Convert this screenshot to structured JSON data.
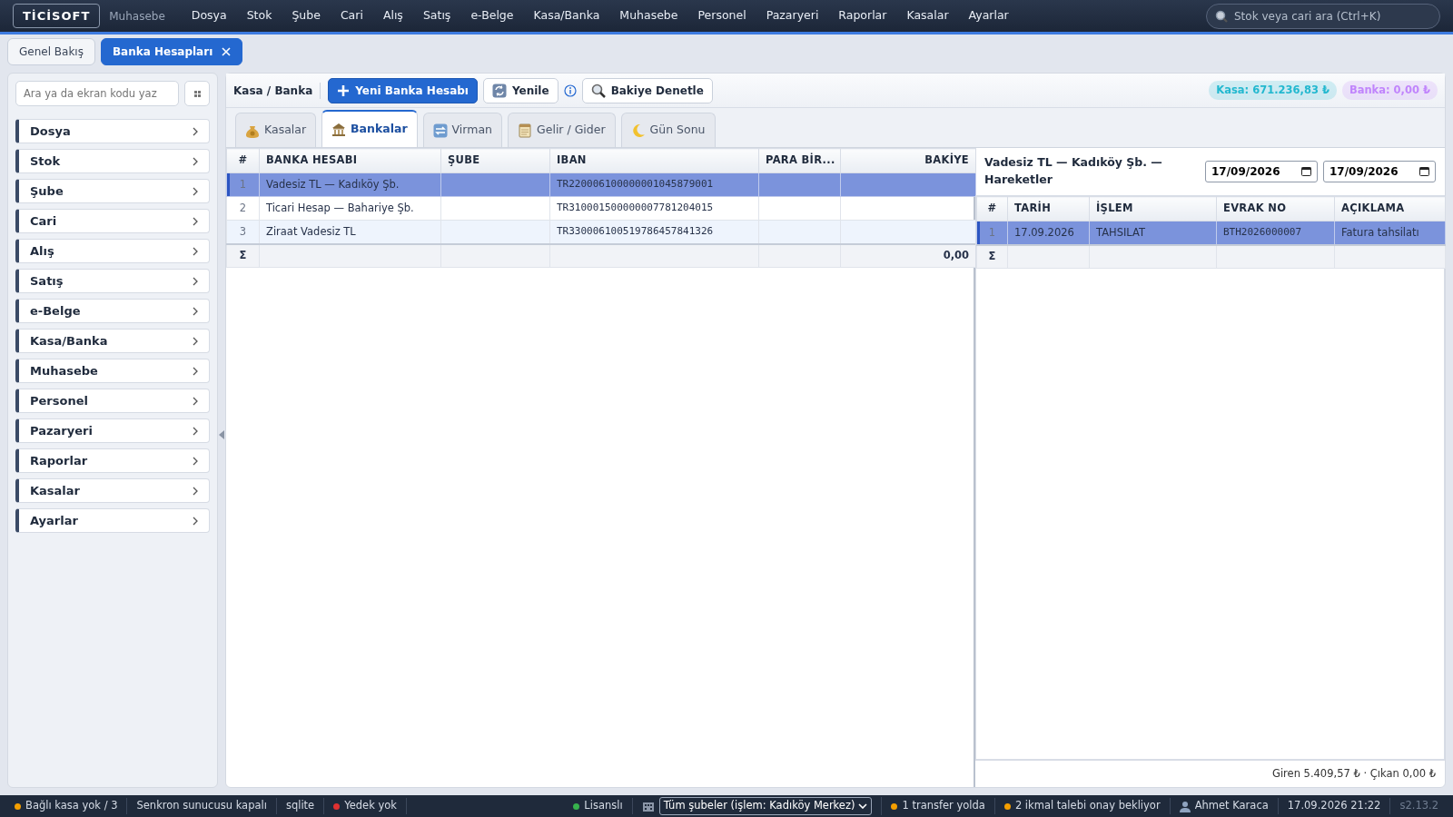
{
  "app": {
    "logo": "TİCİSOFT",
    "module": "Muhasebe"
  },
  "menu": [
    "Dosya",
    "Stok",
    "Şube",
    "Cari",
    "Alış",
    "Satış",
    "e-Belge",
    "Kasa/Banka",
    "Muhasebe",
    "Personel",
    "Pazaryeri",
    "Raporlar",
    "Kasalar",
    "Ayarlar"
  ],
  "search": {
    "placeholder": "Stok veya cari ara (Ctrl+K)"
  },
  "doc_tabs": [
    {
      "label": "Genel Bakış",
      "selected": false,
      "closable": false
    },
    {
      "label": "Banka Hesapları",
      "selected": true,
      "closable": true
    }
  ],
  "sidebar": {
    "search": {
      "placeholder": "Ara ya da ekran kodu yaz"
    },
    "items": [
      "Dosya",
      "Stok",
      "Şube",
      "Cari",
      "Alış",
      "Satış",
      "e-Belge",
      "Kasa/Banka",
      "Muhasebe",
      "Personel",
      "Pazaryeri",
      "Raporlar",
      "Kasalar",
      "Ayarlar"
    ]
  },
  "toolbar": {
    "title": "Kasa / Banka",
    "buttons": [
      {
        "label": "Yeni Banka Hesabı",
        "kind": "primary"
      },
      {
        "label": "Yenile",
        "kind": "secondary"
      },
      {
        "kind": "info"
      },
      {
        "label": "Bakiye Denetle",
        "kind": "secondary"
      }
    ],
    "badges": [
      {
        "text": "Kasa: 671.236,83 ₺",
        "color": "#22b8cf"
      },
      {
        "text": "Banka: 0,00 ₺",
        "color": "#c084fc"
      }
    ]
  },
  "tabs": [
    {
      "label": "Kasalar",
      "selected": false
    },
    {
      "label": "Bankalar",
      "selected": true
    },
    {
      "label": "Virman",
      "selected": false
    },
    {
      "label": "Gelir / Gider",
      "selected": false
    },
    {
      "label": "Gün Sonu",
      "selected": false
    }
  ],
  "accounts_table": {
    "columns": [
      "#",
      "BANKA HESABI",
      "ŞUBE",
      "IBAN",
      "PARA BİR...",
      "BAKİYE"
    ],
    "rows": [
      {
        "cells": [
          "1",
          "Vadesiz TL — Kadıköy Şb.",
          "",
          "TR220006100000001045879001",
          "",
          ""
        ],
        "selected": true
      },
      {
        "cells": [
          "2",
          "Ticari Hesap — Bahariye Şb.",
          "",
          "TR310001500000007781204015",
          "",
          ""
        ],
        "selected": false
      },
      {
        "cells": [
          "3",
          "Ziraat Vadesiz TL",
          "",
          "TR330006100519786457841326",
          "",
          ""
        ],
        "selected": false
      }
    ],
    "footer": {
      "symbol": "Σ",
      "total": "0,00"
    }
  },
  "movements": {
    "title": "Vadesiz TL — Kadıköy Şb. — Hareketler",
    "date_from": "17/09/2026",
    "date_to": "17/09/2026",
    "columns": [
      "#",
      "TARİH",
      "İŞLEM",
      "EVRAK NO",
      "AÇIKLAMA"
    ],
    "rows": [
      {
        "cells": [
          "1",
          "17.09.2026",
          "TAHSILAT",
          "BTH2026000007",
          "Fatura tahsilatı"
        ],
        "selected": true
      }
    ],
    "footer": {
      "symbol": "Σ"
    },
    "summary": "Giren 5.409,57 ₺ · Çıkan 0,00 ₺"
  },
  "status_bar": {
    "left": [
      {
        "text": "Bağlı kasa yok / 3",
        "color": "#f59f00"
      },
      {
        "text": "Senkron sunucusu kapalı"
      },
      {
        "text": "sqlite"
      },
      {
        "text": "Yedek yok",
        "color": "#e03131"
      }
    ],
    "right": [
      {
        "kind": "dot",
        "text": "Lisanslı",
        "color": "#37b24d"
      },
      {
        "kind": "select",
        "text": "Tüm şubeler (işlem: Kadıköy Merkez)"
      },
      {
        "kind": "dot",
        "text": "1 transfer yolda",
        "color": "#f59f00"
      },
      {
        "kind": "dot",
        "text": "2 ikmal talebi onay bekliyor",
        "color": "#f59f00"
      },
      {
        "kind": "user",
        "text": "Ahmet Karaca"
      },
      {
        "kind": "text",
        "text": "17.09.2026 21:22"
      },
      {
        "kind": "version",
        "text": "s2.13.2"
      }
    ]
  }
}
